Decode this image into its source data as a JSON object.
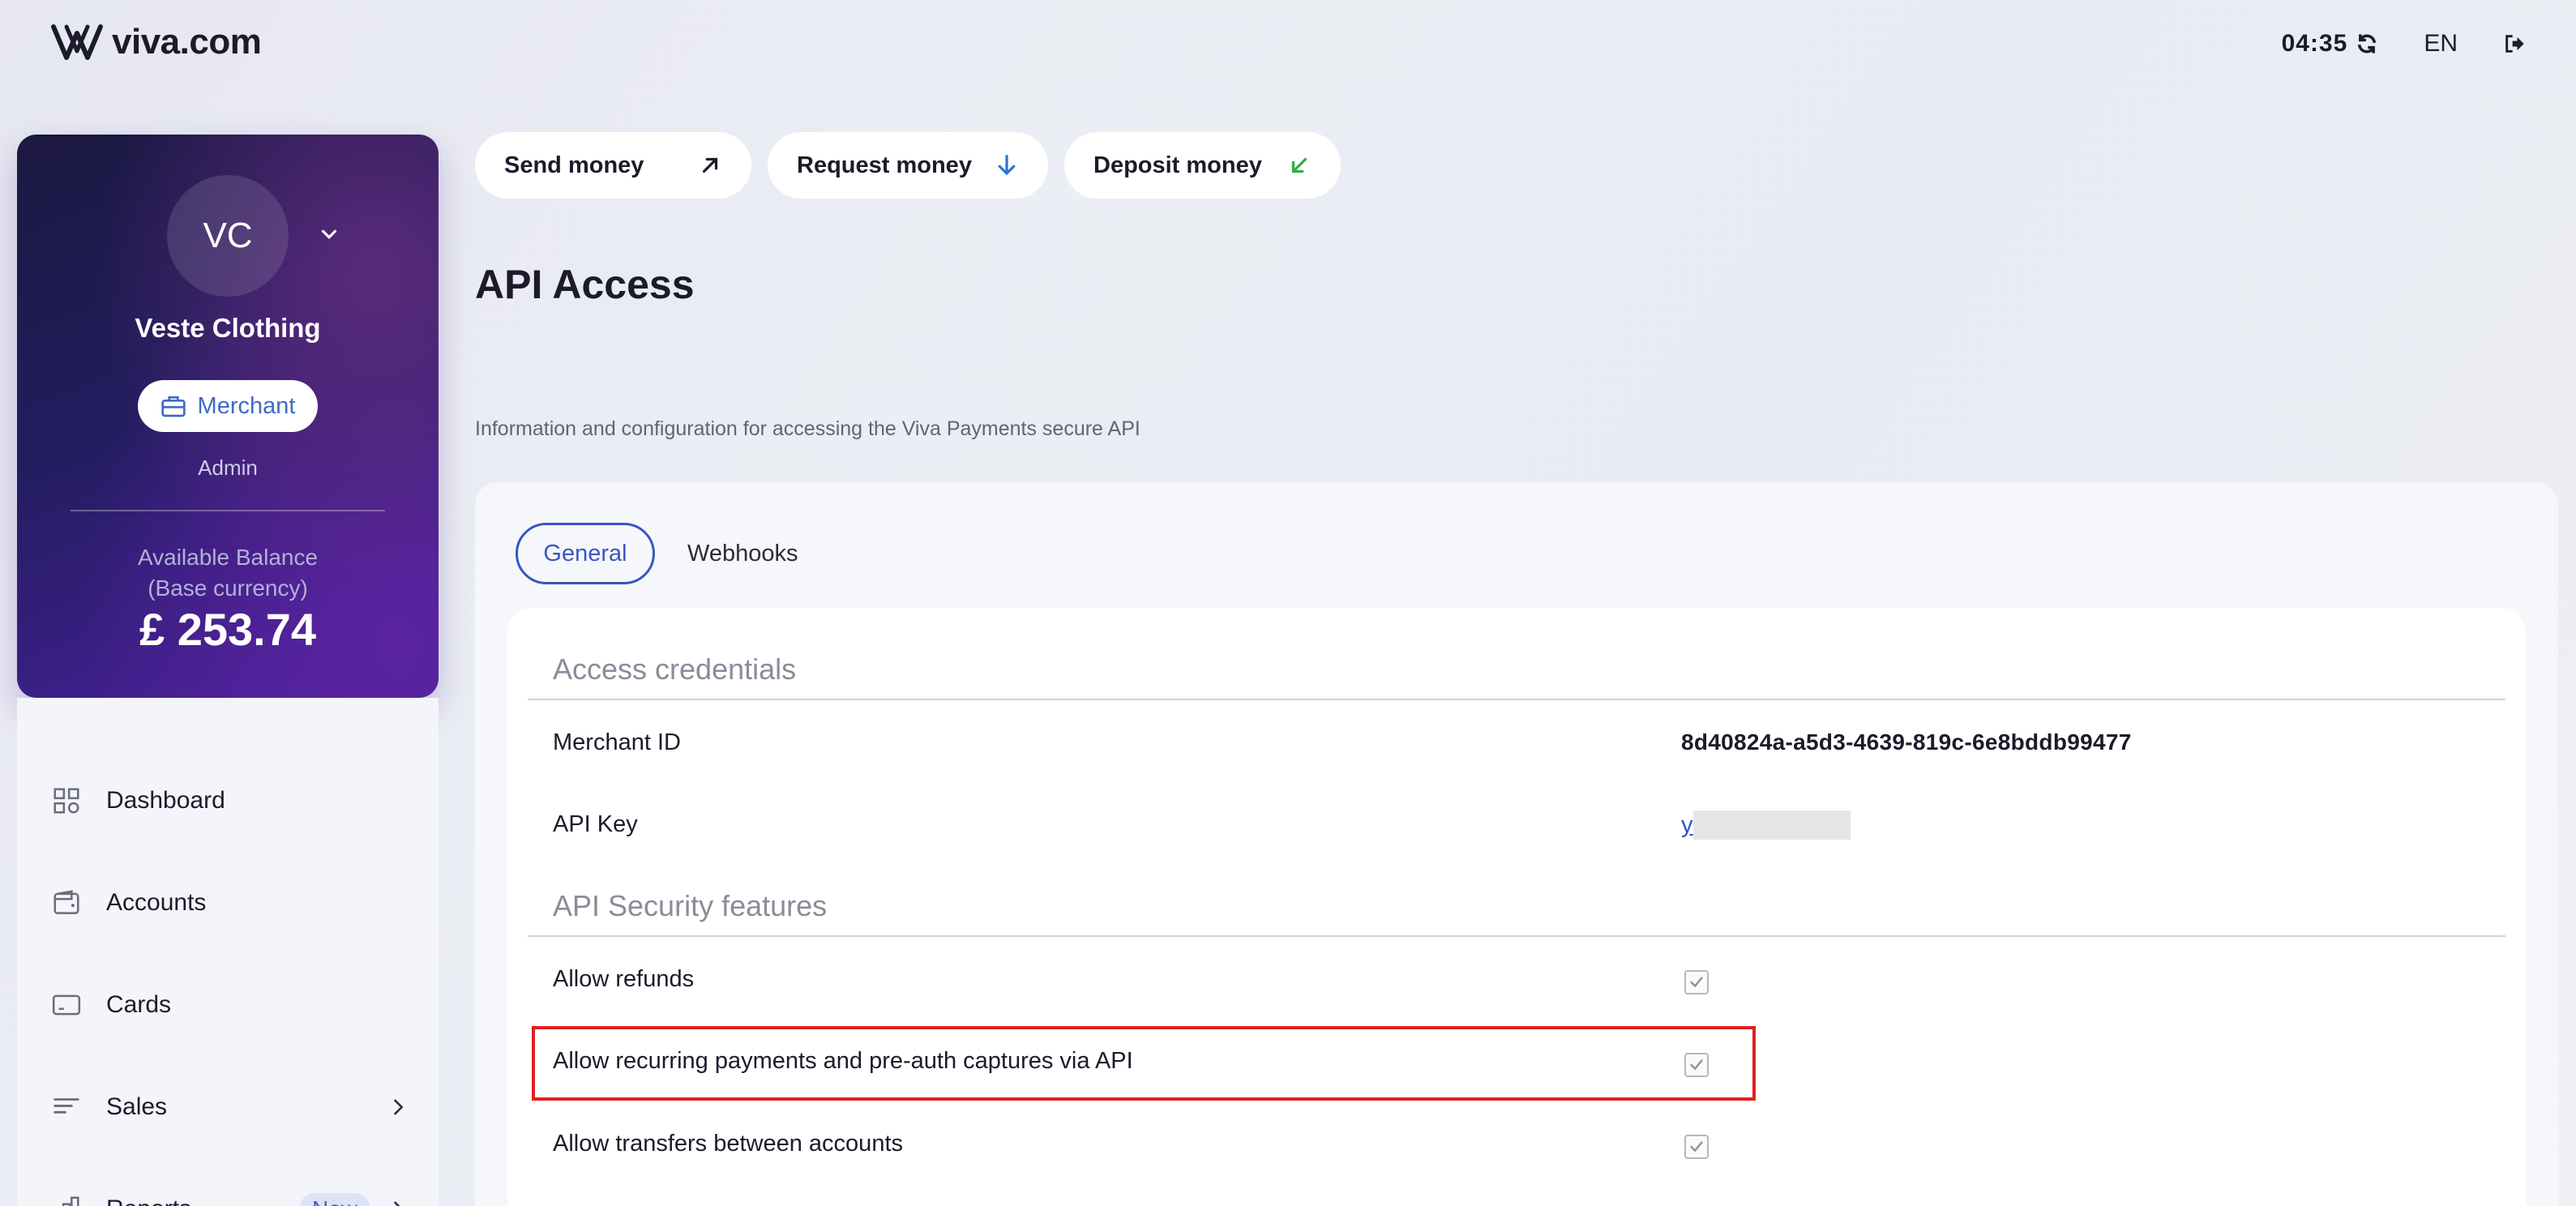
{
  "brand": {
    "logo_text": "viva.com"
  },
  "topbar": {
    "time": "04:35",
    "language": "EN"
  },
  "profile": {
    "initials": "VC",
    "name": "Veste Clothing",
    "role": "Merchant",
    "sub_role": "Admin",
    "balance_label_line1": "Available Balance",
    "balance_label_line2": "(Base currency)",
    "balance": "£ 253.74"
  },
  "sidebar": {
    "items": [
      {
        "label": "Dashboard",
        "icon": "grid-icon"
      },
      {
        "label": "Accounts",
        "icon": "wallet-icon"
      },
      {
        "label": "Cards",
        "icon": "card-icon"
      },
      {
        "label": "Sales",
        "icon": "lines-icon"
      },
      {
        "label": "Reports",
        "icon": "bar-chart-icon",
        "badge": "New"
      }
    ]
  },
  "actions": {
    "send": "Send money",
    "request": "Request money",
    "deposit": "Deposit money"
  },
  "page": {
    "title": "API Access",
    "description": "Information and configuration for accessing the Viva Payments secure API"
  },
  "tabs": {
    "general": "General",
    "webhooks": "Webhooks"
  },
  "credentials": {
    "section_title": "Access credentials",
    "merchant_id_label": "Merchant ID",
    "merchant_id_value": "8d40824a-a5d3-4639-819c-6e8bddb99477",
    "api_key_label": "API Key",
    "api_key_value": "y"
  },
  "security": {
    "section_title": "API Security features",
    "features": [
      {
        "label": "Allow refunds",
        "checked": true
      },
      {
        "label": "Allow recurring payments and pre-auth captures via API",
        "checked": true
      },
      {
        "label": "Allow transfers between accounts",
        "checked": true
      }
    ]
  },
  "colors": {
    "accent": "#3a55c4",
    "highlight": "#e02020",
    "card_dark": "#221d5e"
  }
}
